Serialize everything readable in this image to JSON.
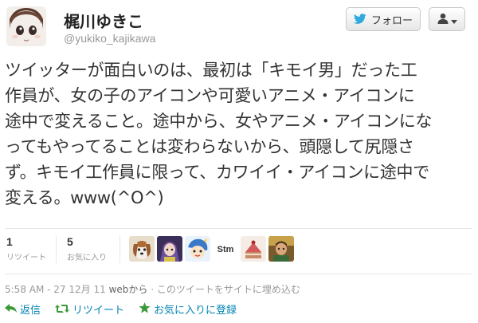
{
  "header": {
    "display_name": "梶川ゆきこ",
    "handle": "@yukiko_kajikawa",
    "follow_label": "フォロー",
    "user_menu_icon": "user-icon"
  },
  "tweet": {
    "lines": [
      "ツイッターが面白いのは、最初は「キモイ男」だった工",
      "作員が、女の子のアイコンや可愛いアニメ・アイコンに",
      "途中で変えること。途中から、女やアニメ・アイコンにな",
      "ってもやってることは変わらないから、頭隠して尻隠さ",
      "ず。キモイ工作員に限って、カワイイ・アイコンに途中で",
      "変える。www(^O^)"
    ]
  },
  "stats": {
    "retweets": {
      "count": "1",
      "label": "リツイート"
    },
    "favorites": {
      "count": "5",
      "label": "お気に入り"
    },
    "avatar_names": [
      "dog-avatar",
      "anime-avatar",
      "cartoon-avatar",
      "stm-logo-avatar",
      "sweets-avatar",
      "portrait-avatar"
    ],
    "stm_text": "Stm"
  },
  "meta": {
    "timestamp": "5:58 AM - 27 12月 11",
    "via": "webから",
    "embed": "· このツイートをサイトに埋め込む"
  },
  "actions": [
    {
      "label": "返信",
      "icon": "reply-icon"
    },
    {
      "label": "リツイート",
      "icon": "retweet-icon"
    },
    {
      "label": "お気に入りに登録",
      "icon": "star-icon"
    }
  ],
  "colors": {
    "link": "#0084b4",
    "star": "#3a9a3a",
    "bird": "#2fa9e0"
  }
}
